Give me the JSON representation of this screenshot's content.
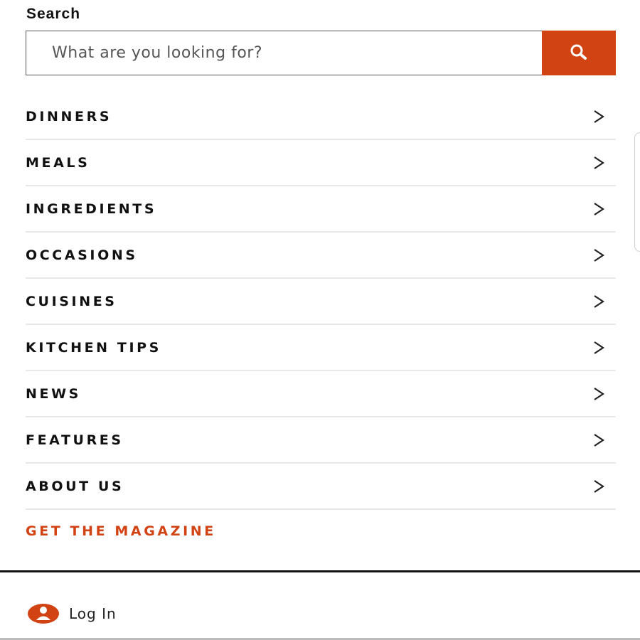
{
  "search": {
    "heading": "Search",
    "placeholder": "What are you looking for?",
    "button_icon": "search-icon"
  },
  "nav": {
    "items": [
      {
        "label": "DINNERS",
        "icon": "chevron-right-icon"
      },
      {
        "label": "MEALS",
        "icon": "chevron-right-icon"
      },
      {
        "label": "INGREDIENTS",
        "icon": "chevron-right-icon"
      },
      {
        "label": "OCCASIONS",
        "icon": "chevron-right-icon"
      },
      {
        "label": "CUISINES",
        "icon": "chevron-right-icon"
      },
      {
        "label": "KITCHEN TIPS",
        "icon": "chevron-right-icon"
      },
      {
        "label": "NEWS",
        "icon": "chevron-right-icon"
      },
      {
        "label": "FEATURES",
        "icon": "chevron-right-icon"
      },
      {
        "label": "ABOUT US",
        "icon": "chevron-right-icon"
      }
    ],
    "magazine_label": "GET THE MAGAZINE"
  },
  "account": {
    "login_label": "Log In",
    "icon": "user-icon"
  },
  "colors": {
    "accent": "#d24314",
    "text": "#111111",
    "divider": "#e8e8e8"
  }
}
